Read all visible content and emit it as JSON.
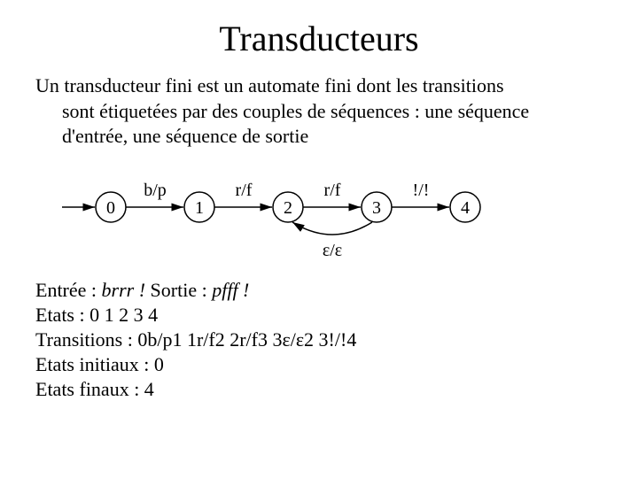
{
  "title": "Transducteurs",
  "definition_line1": "Un transducteur fini est un automate fini dont les transitions",
  "definition_line2": "sont étiquetées par des couples de séquences : une séquence",
  "definition_line3": "d'entrée, une séquence de sortie",
  "automaton": {
    "states": [
      "0",
      "1",
      "2",
      "3",
      "4"
    ],
    "transitions": [
      {
        "from": "0",
        "to": "1",
        "label": "b/p"
      },
      {
        "from": "1",
        "to": "2",
        "label": "r/f"
      },
      {
        "from": "2",
        "to": "3",
        "label": "r/f"
      },
      {
        "from": "3",
        "to": "2",
        "label": "ε/ε",
        "back": true
      },
      {
        "from": "3",
        "to": "4",
        "label": "!/!"
      }
    ],
    "initial": "0",
    "final": "4"
  },
  "example_entry_label": "Entrée : ",
  "example_entry_value": "brrr !",
  "example_output_label": " Sortie : ",
  "example_output_value": "pfff !",
  "states_line": "Etats : 0 1 2 3 4",
  "transitions_line": "Transitions : 0b/p1 1r/f2 2r/f3 3ε/ε2 3!/!4",
  "initial_line": "Etats initiaux : 0",
  "final_line": "Etats finaux : 4"
}
